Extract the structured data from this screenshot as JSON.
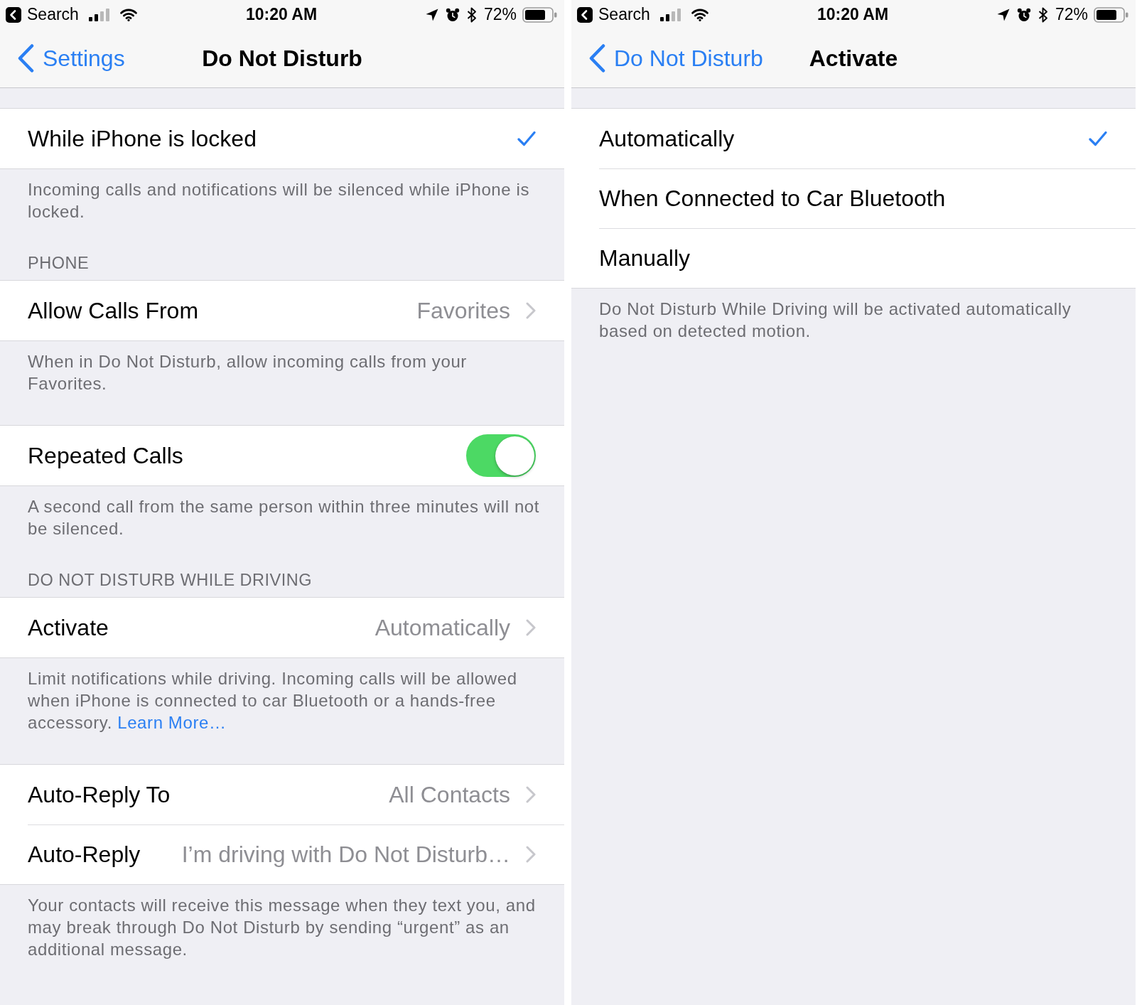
{
  "screens": [
    {
      "status_bar": {
        "back_app": "Search",
        "time": "10:20 AM",
        "battery": "72%"
      },
      "nav_bar": {
        "back": "Settings",
        "title": "Do Not Disturb"
      },
      "sections": [
        {
          "rows": [
            {
              "kind": "option",
              "label": "While iPhone is locked",
              "selected": true
            }
          ],
          "footer": "Incoming calls and notifications will be silenced while iPhone is locked."
        },
        {
          "header": "PHONE",
          "rows": [
            {
              "kind": "link",
              "label": "Allow Calls From",
              "value": "Favorites"
            }
          ],
          "footer": "When in Do Not Disturb, allow incoming calls from your Favorites."
        },
        {
          "rows": [
            {
              "kind": "toggle",
              "label": "Repeated Calls",
              "on": true
            }
          ],
          "footer": "A second call from the same person within three minutes will not be silenced."
        },
        {
          "header": "DO NOT DISTURB WHILE DRIVING",
          "rows": [
            {
              "kind": "link",
              "label": "Activate",
              "value": "Automatically"
            }
          ],
          "footer": "Limit notifications while driving. Incoming calls will be allowed when iPhone is connected to car Bluetooth or a hands-free accessory.",
          "footer_link": "Learn More…"
        },
        {
          "rows": [
            {
              "kind": "link",
              "label": "Auto-Reply To",
              "value": "All Contacts"
            },
            {
              "kind": "link",
              "label": "Auto-Reply",
              "value": "I’m driving with Do Not Disturb…"
            }
          ],
          "footer": "Your contacts will receive this message when they text you, and may break through Do Not Disturb by sending “urgent” as an additional message."
        }
      ]
    },
    {
      "status_bar": {
        "back_app": "Search",
        "time": "10:20 AM",
        "battery": "72%"
      },
      "nav_bar": {
        "back": "Do Not Disturb",
        "title": "Activate"
      },
      "sections": [
        {
          "rows": [
            {
              "kind": "option",
              "label": "Automatically",
              "selected": true
            },
            {
              "kind": "option",
              "label": "When Connected to Car Bluetooth",
              "selected": false
            },
            {
              "kind": "option",
              "label": "Manually",
              "selected": false
            }
          ],
          "footer": "Do Not Disturb While Driving will be activated automatically based on detected motion."
        }
      ]
    }
  ]
}
